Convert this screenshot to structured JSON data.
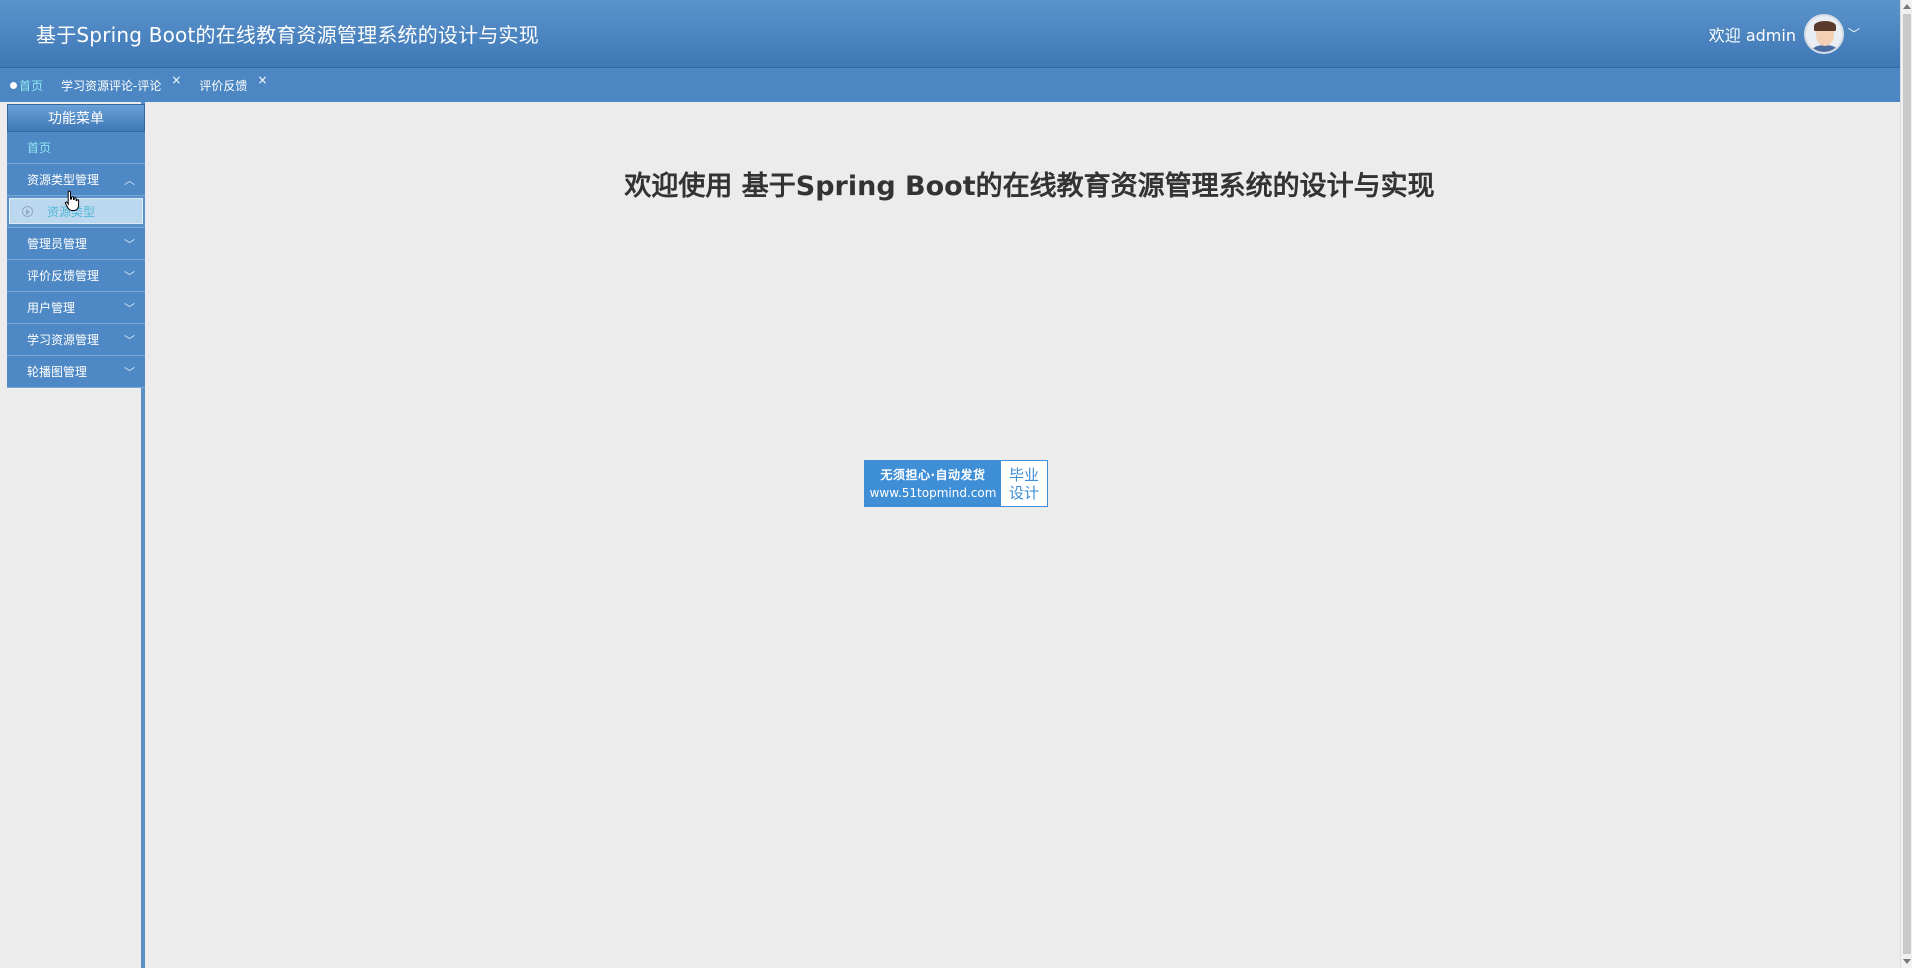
{
  "header": {
    "title": "基于Spring Boot的在线教育资源管理系统的设计与实现",
    "welcome": "欢迎 admin",
    "avatar_icon": "user-avatar",
    "dropdown_icon": "chevron-down-icon"
  },
  "tabs": [
    {
      "label": "首页",
      "active": true
    },
    {
      "label": "学习资源评论-评论",
      "close": "×"
    },
    {
      "label": "评价反馈",
      "close": "×"
    }
  ],
  "sidebar": {
    "title": "功能菜单",
    "items": [
      {
        "label": "首页"
      },
      {
        "label": "资源类型管理",
        "expanded": true,
        "chevron": "︿"
      },
      {
        "label": "资源类型"
      },
      {
        "label": "管理员管理",
        "chevron": "﹀"
      },
      {
        "label": "评价反馈管理",
        "chevron": "﹀"
      },
      {
        "label": "用户管理",
        "chevron": "﹀"
      },
      {
        "label": "学习资源管理",
        "chevron": "﹀"
      },
      {
        "label": "轮播图管理",
        "chevron": "﹀"
      }
    ]
  },
  "main": {
    "heading": "欢迎使用 基于Spring Boot的在线教育资源管理系统的设计与实现",
    "badge": {
      "line1": "无须担心·自动发货",
      "line2": "www.51topmind.com",
      "right1": "毕业",
      "right2": "设计"
    }
  },
  "colors": {
    "header_blue": "#4a85c2",
    "tab_active": "#8fe7f2",
    "badge_blue": "#3f8fd6"
  }
}
